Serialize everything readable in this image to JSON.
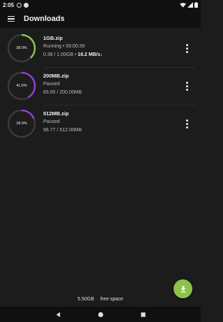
{
  "status_bar": {
    "time": "2:05",
    "icons": [
      "circle-notification-icon",
      "notification-icon",
      "wifi-icon",
      "signal-icon",
      "battery-icon"
    ]
  },
  "app_bar": {
    "title": "Downloads",
    "menu_icon": "hamburger-menu-icon"
  },
  "downloads": [
    {
      "percent_label": "38.0%",
      "progress": 0.38,
      "ring_color": "#8bc34a",
      "filename": "1GB.zip",
      "status": "Running",
      "separator": " • ",
      "elapsed": "00:00:39",
      "progress_text": "0.38 / 1.00GB",
      "separator2": " • ",
      "speed": "16.2 MB/s",
      "speed_arrow": "↓"
    },
    {
      "percent_label": "41.5%",
      "progress": 0.415,
      "ring_color": "#8e3fd8",
      "filename": "200MB.zip",
      "status": "Paused",
      "progress_text": "83.00 / 200.00MB"
    },
    {
      "percent_label": "18.9%",
      "progress": 0.189,
      "ring_color": "#8e3fd8",
      "filename": "512MB.zip",
      "status": "Paused",
      "progress_text": "96.77 / 512.00MB"
    }
  ],
  "footer": {
    "free_value": "5.50GB",
    "free_label": "free space"
  },
  "fab": {
    "icon": "download-icon",
    "color": "#8bc34a"
  },
  "nav_bar": {
    "icons": [
      "back-icon",
      "home-icon",
      "recents-icon"
    ]
  }
}
